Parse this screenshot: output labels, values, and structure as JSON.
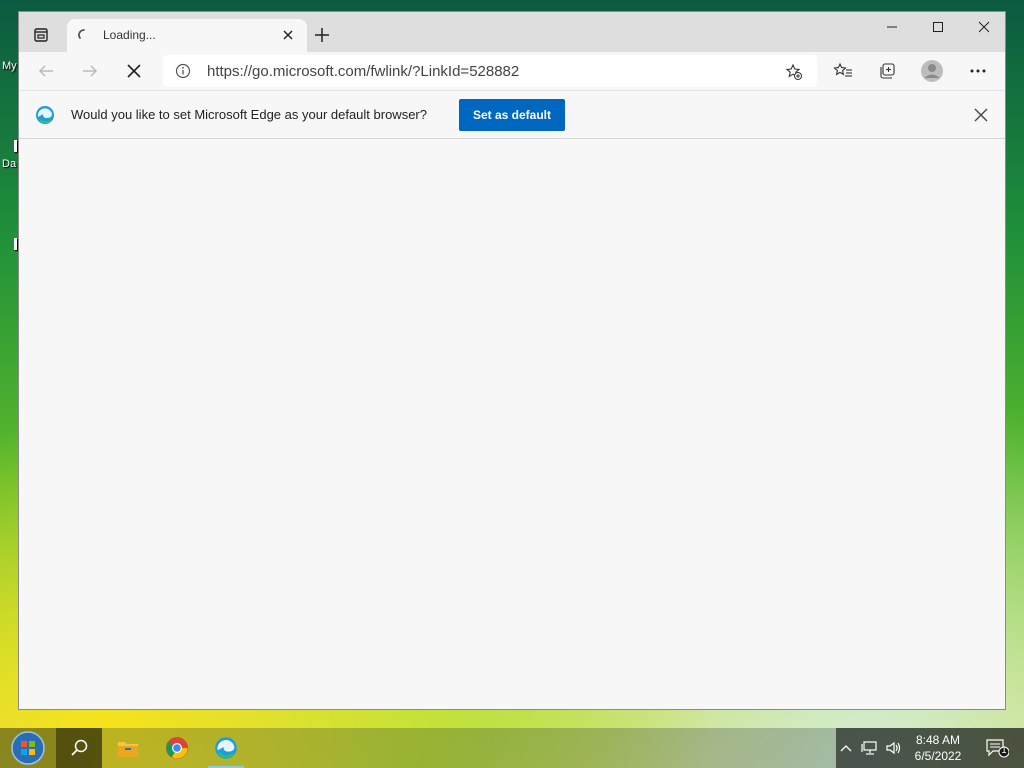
{
  "desktop": {
    "icon_label_1": "My",
    "icon_label_2": "Da"
  },
  "browser": {
    "tab": {
      "title": "Loading..."
    },
    "address": {
      "url": "https://go.microsoft.com/fwlink/?LinkId=528882"
    },
    "infobar": {
      "message": "Would you like to set Microsoft Edge as your default browser?",
      "button_label": "Set as default"
    }
  },
  "taskbar": {
    "clock": {
      "time": "8:48 AM",
      "date": "6/5/2022"
    },
    "notification_count": "1"
  },
  "colors": {
    "accent": "#0067c0"
  }
}
